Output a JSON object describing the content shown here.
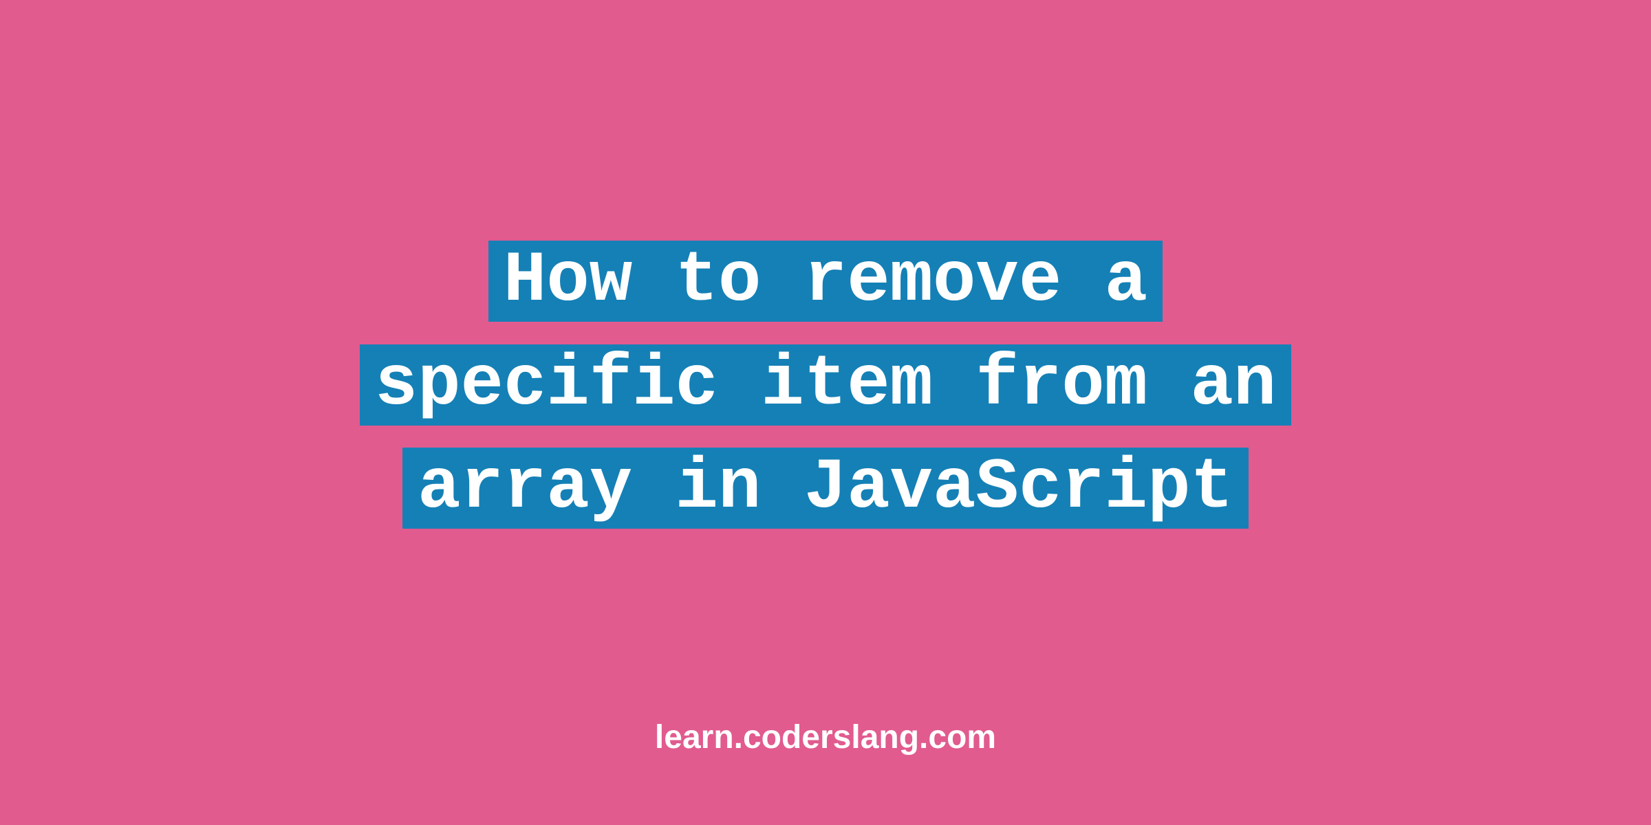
{
  "title": {
    "line1": "How to remove a",
    "line2": "specific item from an",
    "line3": "array in JavaScript"
  },
  "footer": {
    "text": "learn.coderslang.com"
  },
  "colors": {
    "background": "#e15b8f",
    "highlight": "#1580b6",
    "text": "#ffffff"
  }
}
